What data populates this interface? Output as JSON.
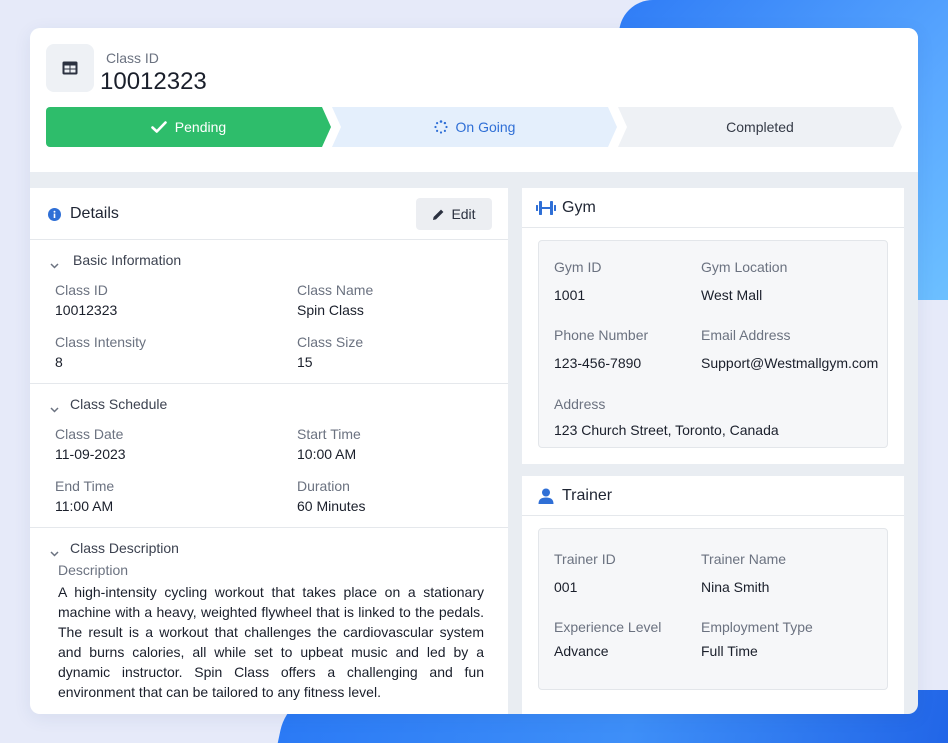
{
  "header": {
    "label": "Class ID",
    "value": "10012323",
    "steps": [
      "Pending",
      "On Going",
      "Completed"
    ]
  },
  "details": {
    "title": "Details",
    "edit_label": "Edit",
    "basic": {
      "title": "Basic Information",
      "fields": [
        {
          "label": "Class ID",
          "value": "10012323"
        },
        {
          "label": "Class Name",
          "value": "Spin Class"
        },
        {
          "label": "Class Intensity",
          "value": "8"
        },
        {
          "label": "Class Size",
          "value": "15"
        }
      ]
    },
    "schedule": {
      "title": "Class Schedule",
      "fields": [
        {
          "label": "Class Date",
          "value": "11-09-2023"
        },
        {
          "label": "Start Time",
          "value": "10:00 AM"
        },
        {
          "label": "End Time",
          "value": "11:00 AM"
        },
        {
          "label": "Duration",
          "value": "60 Minutes"
        }
      ]
    },
    "description": {
      "title": "Class Description",
      "label": "Description",
      "text": "A high-intensity cycling workout that takes place on a stationary machine with a heavy, weighted flywheel that is linked to the pedals. The result is a workout that challenges the cardiovascular system and burns calories, all while set to upbeat music and led by a dynamic instructor. Spin Class offers a challenging and fun environment that can be tailored to any fitness level."
    }
  },
  "gym": {
    "title": "Gym",
    "fields": [
      {
        "label": "Gym ID",
        "value": "1001"
      },
      {
        "label": "Gym Location",
        "value": "West Mall"
      },
      {
        "label": "Phone Number",
        "value": "123-456-7890"
      },
      {
        "label": "Email Address",
        "value": "Support@Westmallgym.com"
      },
      {
        "label": "Address",
        "value": "123 Church Street, Toronto, Canada"
      }
    ]
  },
  "trainer": {
    "title": "Trainer",
    "fields": [
      {
        "label": "Trainer ID",
        "value": "001"
      },
      {
        "label": "Trainer Name",
        "value": "Nina Smith"
      },
      {
        "label": "Experience Level",
        "value": "Advance"
      },
      {
        "label": "Employment Type",
        "value": "Full Time"
      }
    ]
  },
  "colors": {
    "accent_blue": "#2f6fd6",
    "success_green": "#2ebd6b",
    "background_blue": "#2f7cf6"
  },
  "icons": [
    "table-icon",
    "check-icon",
    "spinner-icon",
    "info-icon",
    "pencil-icon",
    "chevron-down-icon",
    "dumbbell-icon",
    "user-icon"
  ]
}
